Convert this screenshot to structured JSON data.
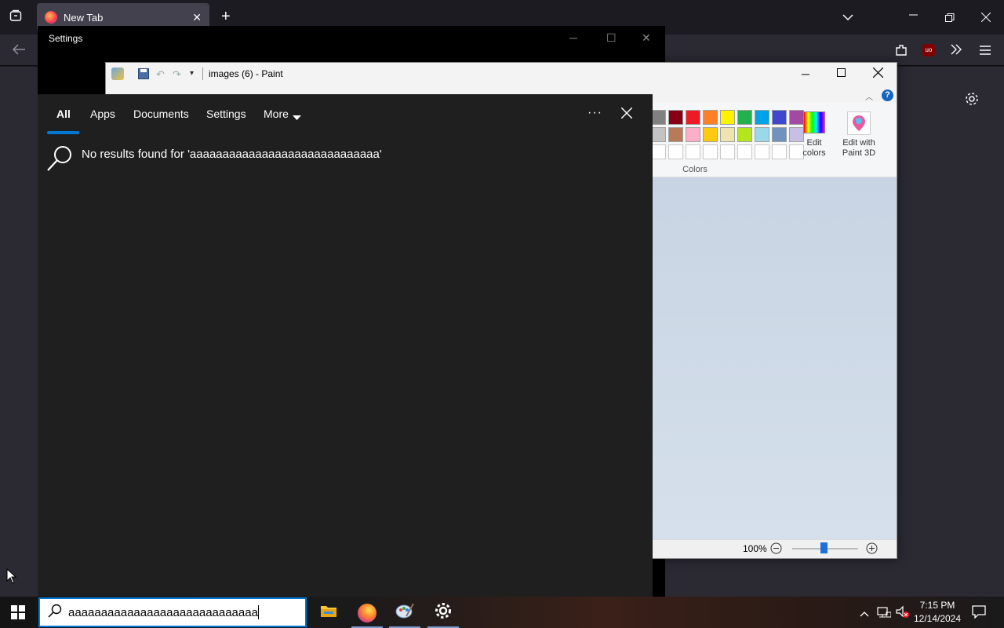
{
  "firefox": {
    "tab_title": "New Tab",
    "new_tab_label": "+"
  },
  "settings_window": {
    "title": "Settings"
  },
  "paint": {
    "title": "images (6) - Paint",
    "colors_group_label": "Colors",
    "edit_colors_label": "Edit colors",
    "edit_paint3d_label": "Edit with Paint 3D",
    "zoom": "100%",
    "palette_row1": [
      "#808080",
      "#880015",
      "#ed1c24",
      "#ff7f27",
      "#fff200",
      "#22b14c",
      "#00a2e8",
      "#3f48cc",
      "#a349a4"
    ],
    "palette_row2": [
      "#c3c3c3",
      "#b97a57",
      "#ffaec9",
      "#ffc90e",
      "#efe4b0",
      "#b5e61d",
      "#99d9ea",
      "#7092be",
      "#c8bfe7"
    ]
  },
  "search": {
    "tabs": [
      {
        "label": "All"
      },
      {
        "label": "Apps"
      },
      {
        "label": "Documents"
      },
      {
        "label": "Settings"
      },
      {
        "label": "More"
      }
    ],
    "no_results_text": "No results found for 'aaaaaaaaaaaaaaaaaaaaaaaaaaaaa'",
    "query": "aaaaaaaaaaaaaaaaaaaaaaaaaaaaa",
    "accent": "#0078d4"
  },
  "taskbar": {
    "time": "7:15 PM",
    "date": "12/14/2024",
    "apps": [
      "file-explorer-icon",
      "firefox-icon",
      "paint-icon",
      "settings-icon"
    ]
  }
}
